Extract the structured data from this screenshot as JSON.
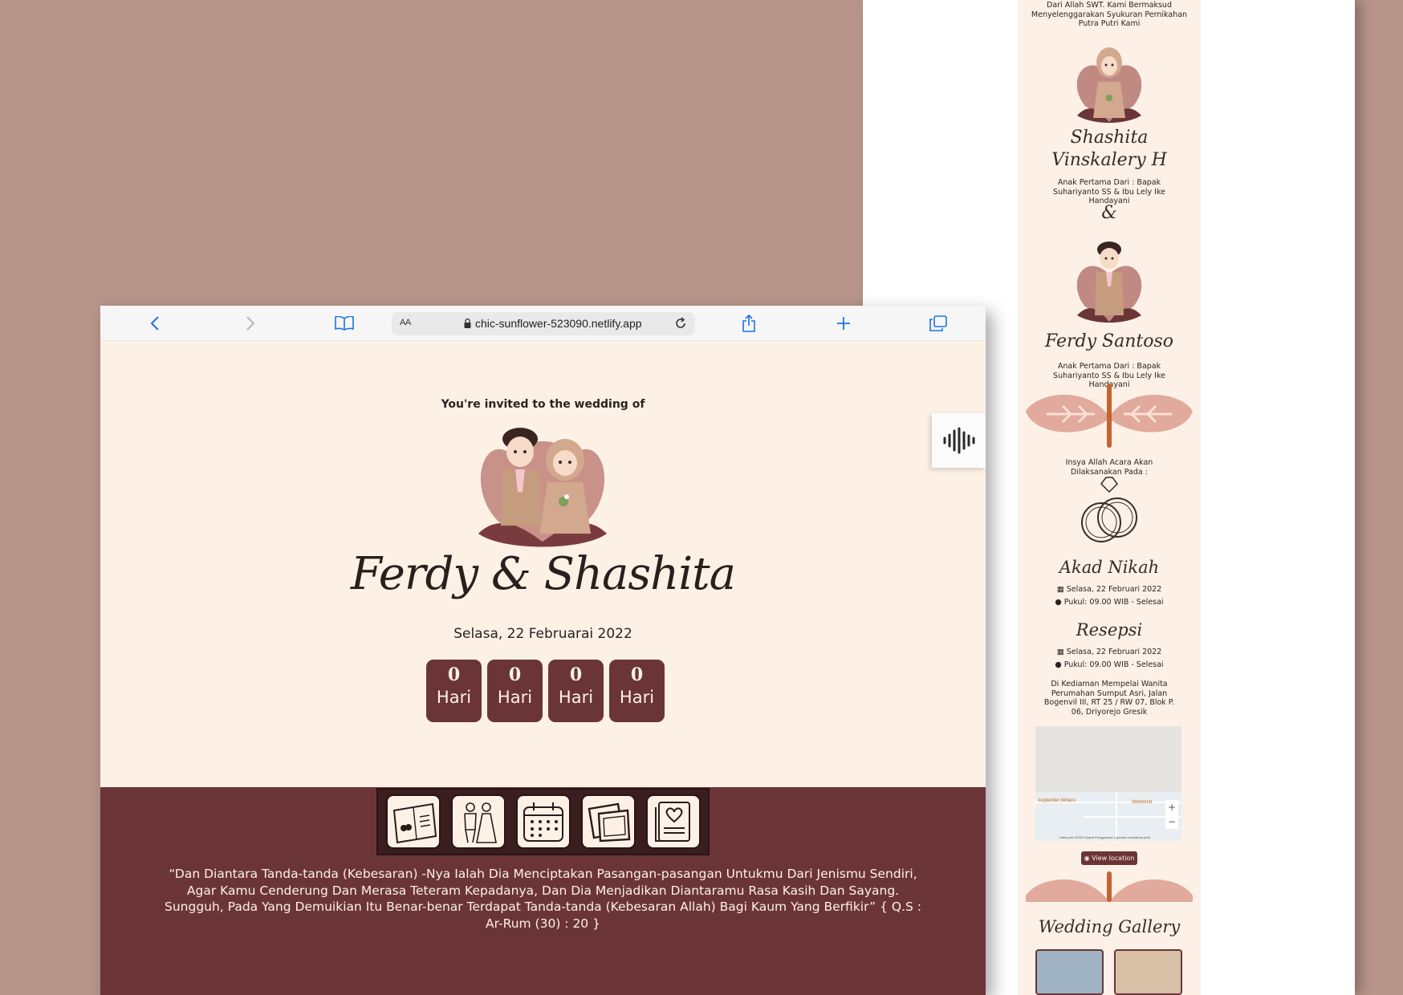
{
  "colors": {
    "background": "#b8958a",
    "page": "#fdf1e6",
    "accent": "#6b3537",
    "nav_dark": "#3a1e1f",
    "browser_blue": "#1a73e8"
  },
  "browser": {
    "text_size_label": "AA",
    "url": "chic-sunflower-523090.netlify.app",
    "icons": [
      "back-icon",
      "forward-icon",
      "bookmarks-icon",
      "lock-icon",
      "reload-icon",
      "share-icon",
      "new-tab-icon",
      "tabs-icon"
    ]
  },
  "hero": {
    "invited": "You're invited to the wedding of",
    "names": "Ferdy & Shashita",
    "date": "Selasa, 22 Februarai 2022",
    "countdown": [
      {
        "value": "0",
        "label": "Hari"
      },
      {
        "value": "0",
        "label": "Hari"
      },
      {
        "value": "0",
        "label": "Hari"
      },
      {
        "value": "0",
        "label": "Hari"
      }
    ]
  },
  "nav_menu": [
    "invitation-card-icon",
    "bride-groom-icon",
    "calendar-icon",
    "photos-icon",
    "guestbook-icon"
  ],
  "quote": "“Dan Diantara Tanda-tanda (Kebesaran) -Nya Ialah Dia Menciptakan Pasangan-pasangan Untukmu Dari Jenismu Sendiri, Agar Kamu Cenderung Dan Merasa Teteram Kepadanya, Dan Dia Menjadikan Diantaramu Rasa Kasih Dan Sayang. Sungguh, Pada Yang Demuikian Itu Benar-benar Terdapat Tanda-tanda (Kebesaran Allah) Bagi Kaum Yang Berfikir” { Q.S : Ar-Rum (30) : 20 }",
  "mobile": {
    "intro": "Dari Allah SWT. Kami Bermaksud Menyelenggarakan Syukuran Pernikahan Putra Putri Kami",
    "bride_name": "Shashita Vinskalery H",
    "bride_parents": "Anak Pertama Dari : Bapak Suhariyanto SS & Ibu Lely Ike Handayani",
    "ampersand": "&",
    "groom_name": "Ferdy Santoso",
    "groom_parents": "Anak Pertama Dari : Bapak Suhariyanto SS & Ibu Lely Ike Handayani",
    "event_intro": "Insya Allah Acara Akan Dilaksanakan Pada :",
    "akad_title": "Akad Nikah",
    "akad_date": "Selasa, 22 Februari 2022",
    "akad_time": "Pukul: 09.00 WIB - Selesai",
    "resepsi_title": "Resepsi",
    "resepsi_date": "Selasa, 22 Februari 2022",
    "resepsi_time": "Pukul: 09.00 WIB - Selesai",
    "address": "Di Kediaman Mempelai Wanita Perumahan Sumput Asri, Jalan Bogenvil III, RT 25 / RW 07, Blok P. 06, Driyorejo Gresik",
    "map_label_1": "kopiwriter bintaro",
    "map_label_2": "Weekend",
    "map_footer": "Data peta ©2023   Syarat Penggunaan   Laporkan kesalahan peta",
    "view_location": "View location",
    "gallery_title": "Wedding Gallery"
  }
}
